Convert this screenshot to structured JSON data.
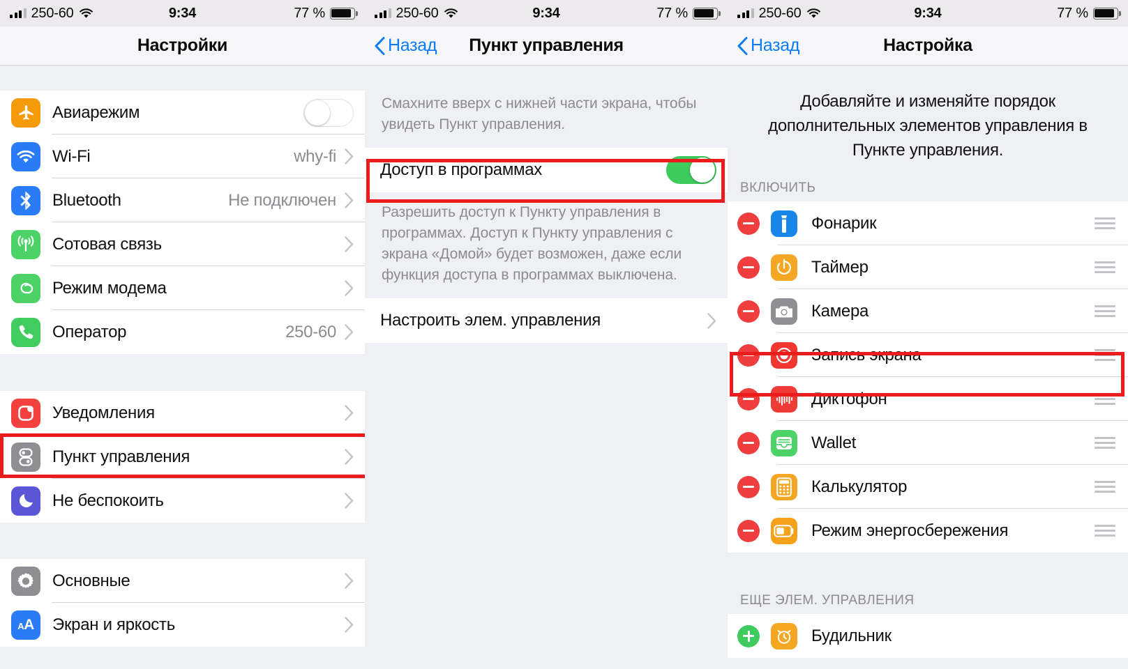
{
  "status_bar": {
    "carrier": "250-60",
    "time": "9:34",
    "battery_percent": "77 %",
    "signal_icon": "cellular-bars-icon",
    "wifi_icon": "wifi-icon",
    "battery_icon": "battery-icon"
  },
  "accent_colors": {
    "highlight_red": "#ec1c1c",
    "link_blue": "#0b7cf7",
    "toggle_green": "#3ecb5d",
    "remove_red": "#f03d3d",
    "secondary_text": "#8b8b90",
    "group_background": "#eff0f4"
  },
  "panel_settings": {
    "title": "Настройки",
    "group1": [
      {
        "label": "Авиарежим",
        "icon": "airplane-icon",
        "icon_color": "#f59a0b",
        "control": "toggle",
        "toggle_on": false
      },
      {
        "label": "Wi-Fi",
        "icon": "wifi-app-icon",
        "icon_color": "#2a7cf6",
        "value": "why-fi",
        "control": "chevron"
      },
      {
        "label": "Bluetooth",
        "icon": "bluetooth-icon",
        "icon_color": "#2a7cf6",
        "value": "Не подключен",
        "control": "chevron"
      },
      {
        "label": "Сотовая связь",
        "icon": "cellular-icon",
        "icon_color": "#4cd267",
        "value": "",
        "control": "chevron"
      },
      {
        "label": "Режим модема",
        "icon": "hotspot-icon",
        "icon_color": "#4cd267",
        "value": "",
        "control": "chevron"
      },
      {
        "label": "Оператор",
        "icon": "phone-icon",
        "icon_color": "#41cc5f",
        "value": "250-60",
        "control": "chevron"
      }
    ],
    "group2": [
      {
        "label": "Уведомления",
        "icon": "notifications-icon",
        "icon_color": "#f43f3f",
        "control": "chevron"
      },
      {
        "label": "Пункт управления",
        "icon": "control-center-icon",
        "icon_color": "#8e8e93",
        "control": "chevron",
        "highlighted": true
      },
      {
        "label": "Не беспокоить",
        "icon": "moon-icon",
        "icon_color": "#5b56d8",
        "control": "chevron"
      }
    ],
    "group3": [
      {
        "label": "Основные",
        "icon": "gear-icon",
        "icon_color": "#8e8e93",
        "control": "chevron"
      },
      {
        "label": "Экран и яркость",
        "icon": "display-brightness-icon",
        "icon_color": "#2a7cf6",
        "control": "chevron"
      }
    ]
  },
  "panel_control_center": {
    "back_label": "Назад",
    "title": "Пункт управления",
    "intro_note": "Смахните вверх с нижней части экрана, чтобы увидеть Пункт управления.",
    "access_row": {
      "label": "Доступ в программах",
      "toggle_on": true,
      "highlighted": true
    },
    "access_note": "Разрешить доступ к Пункту управления в программах. Доступ к Пункту управления с экрана «Домой» будет возможен, даже если функция доступа в программах выключена.",
    "customize_row": {
      "label": "Настроить элем. управления",
      "control": "chevron"
    }
  },
  "panel_customize": {
    "back_label": "Назад",
    "title": "Настройка",
    "intro": "Добавляйте и изменяйте порядок дополнительных элементов управления в Пункте управления.",
    "include_header": "ВКЛЮЧИТЬ",
    "more_header": "ЕЩЕ ЭЛЕМ. УПРАВЛЕНИЯ",
    "included": [
      {
        "label": "Фонарик",
        "icon": "flashlight-icon",
        "icon_color": "#1686e8"
      },
      {
        "label": "Таймер",
        "icon": "timer-icon",
        "icon_color": "#f5a623"
      },
      {
        "label": "Камера",
        "icon": "camera-icon",
        "icon_color": "#8e8e93"
      },
      {
        "label": "Запись экрана",
        "icon": "screen-record-icon",
        "icon_color": "#f1352f",
        "highlighted": true
      },
      {
        "label": "Диктофон",
        "icon": "voice-memos-icon",
        "icon_color": "#ef3b35"
      },
      {
        "label": "Wallet",
        "icon": "wallet-icon",
        "icon_color": "#4cd267"
      },
      {
        "label": "Калькулятор",
        "icon": "calculator-icon",
        "icon_color": "#f5a623"
      },
      {
        "label": "Режим энергосбережения",
        "icon": "low-power-icon",
        "icon_color": "#f5a11a"
      }
    ],
    "more": [
      {
        "label": "Будильник",
        "icon": "alarm-clock-icon",
        "icon_color": "#f5a623"
      }
    ]
  }
}
